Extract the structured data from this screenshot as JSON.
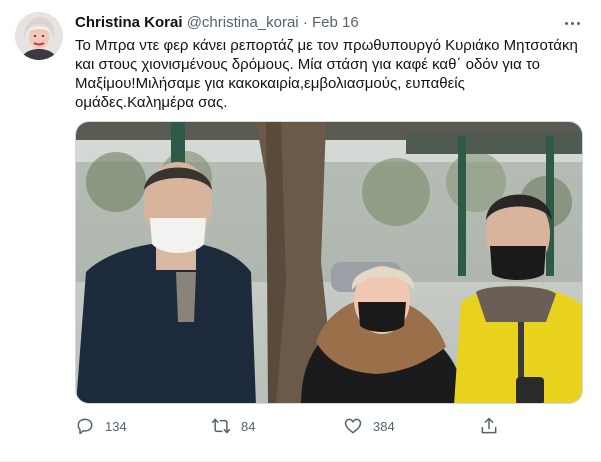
{
  "tweet": {
    "display_name": "Christina Korai",
    "handle": "@christina_korai",
    "separator": "·",
    "date": "Feb 16",
    "text": "Το Μπρα ντε φερ κάνει ρεπορτάζ με τον πρωθυπουργό Κυριάκο Μητσοτάκη και στους χιονισμένους δρόμους. Μία στάση για καφέ καθ΄ οδόν για το Μαξίμου!Μιλήσαμε για κακοκαιρία,εμβολιασμούς, ευπαθείς ομάδες.Καλημέρα σας.",
    "avatar_icon": "avatar-photo",
    "more_icon": "more-horizontal-icon",
    "photo_icon": "attached-photo"
  },
  "actions": {
    "reply": {
      "icon": "reply-icon",
      "count": "134"
    },
    "retweet": {
      "icon": "retweet-icon",
      "count": "84"
    },
    "like": {
      "icon": "heart-icon",
      "count": "384"
    },
    "share": {
      "icon": "share-icon"
    }
  },
  "colors": {
    "text": "#0f1419",
    "muted": "#536471",
    "border": "#cfd9de"
  }
}
